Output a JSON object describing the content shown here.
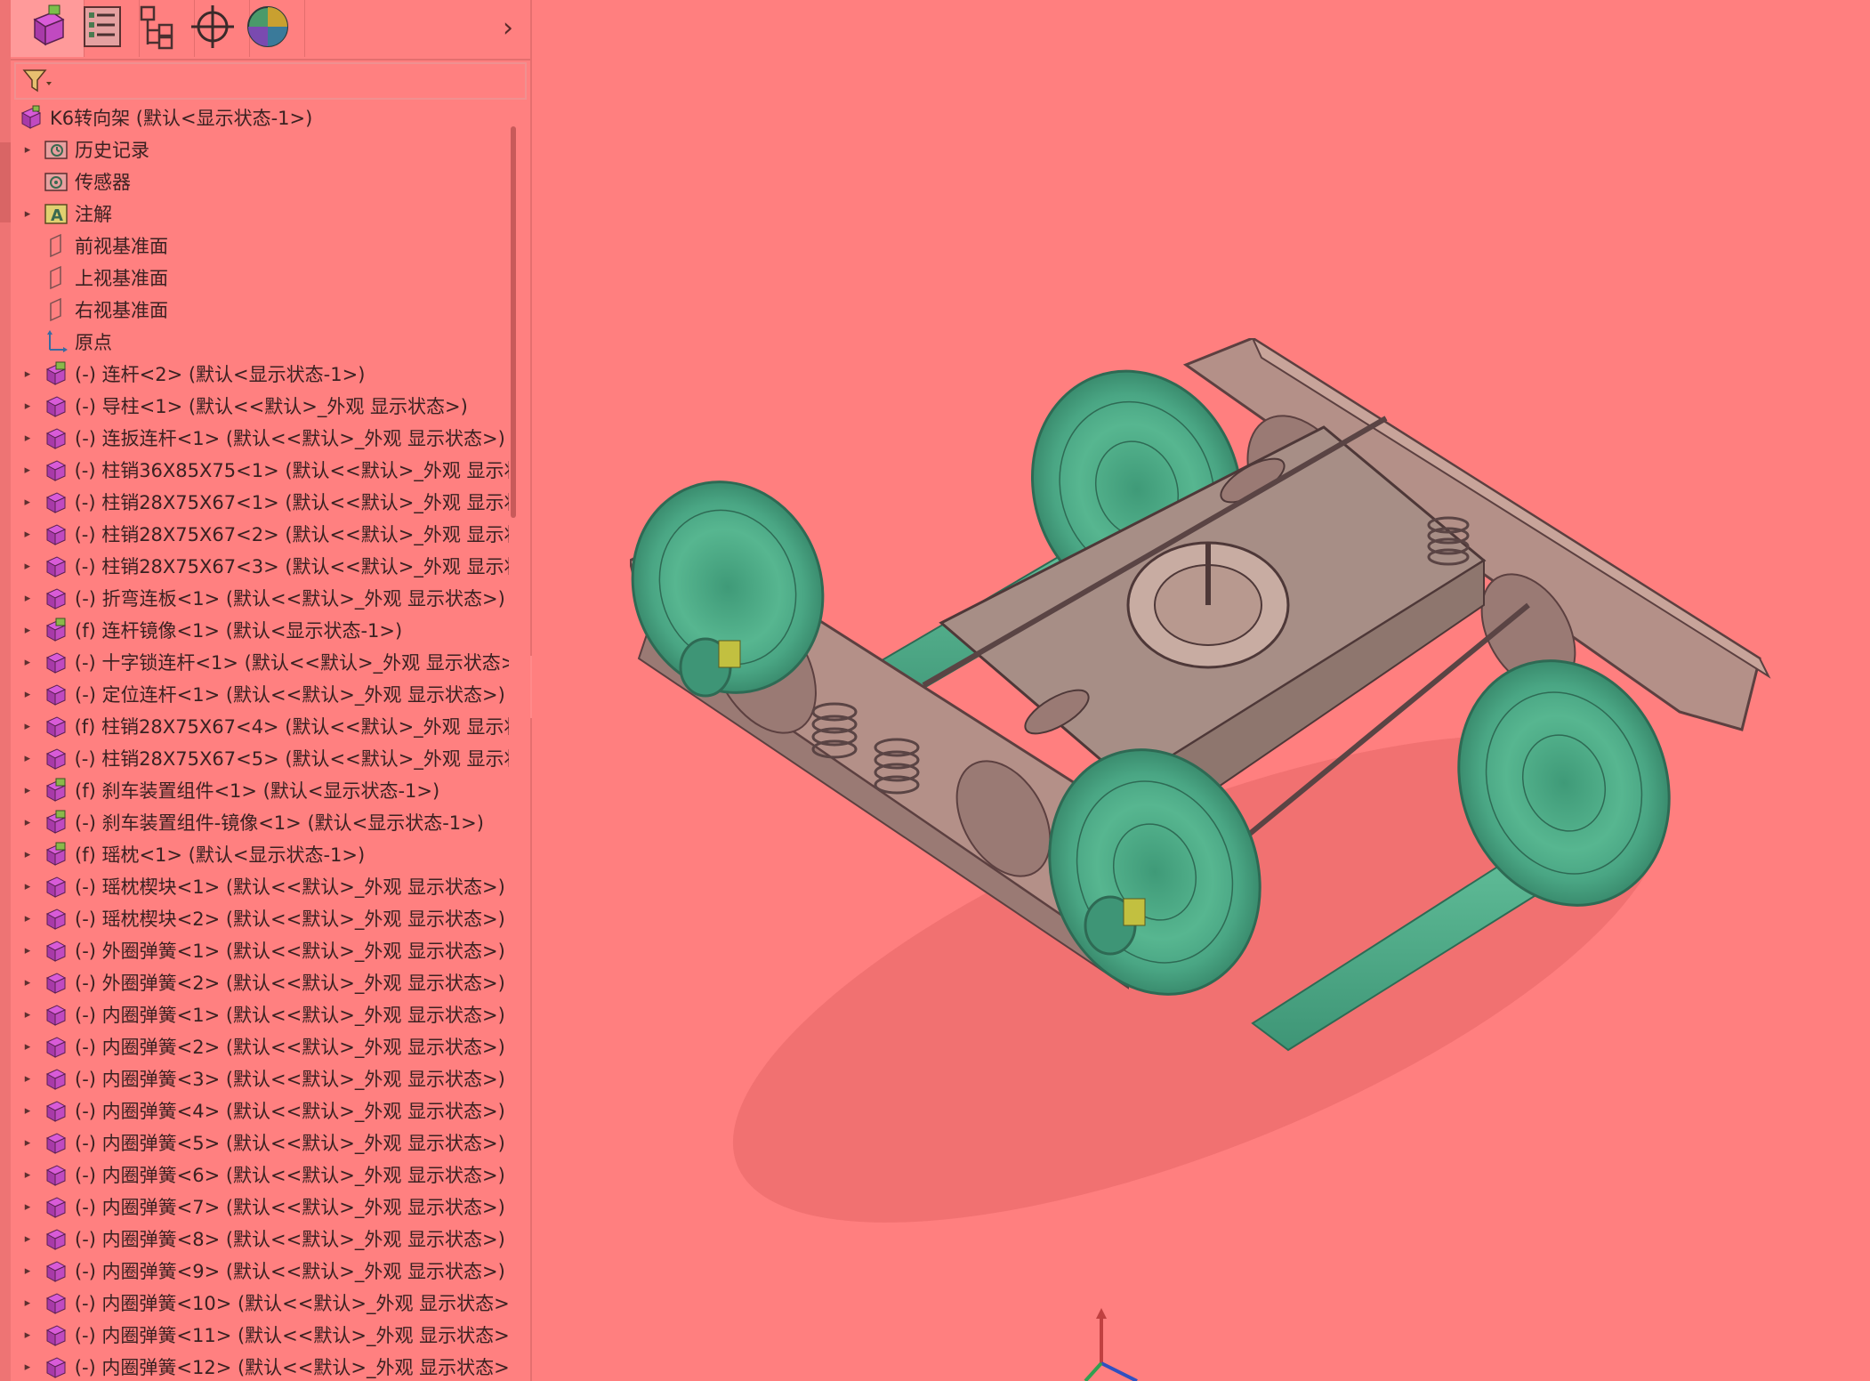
{
  "panel": {
    "tabs": [
      {
        "name": "feature-manager",
        "icon": "assembly-cube-icon"
      },
      {
        "name": "property-manager",
        "icon": "property-list-icon"
      },
      {
        "name": "configuration-manager",
        "icon": "configuration-icon"
      },
      {
        "name": "dimxpert-manager",
        "icon": "crosshair-icon"
      },
      {
        "name": "display-manager",
        "icon": "appearance-sphere-icon"
      }
    ],
    "more_glyph": "›",
    "filter_icon": "filter-funnel-icon"
  },
  "tree": {
    "root": "K6转向架 (默认<显示状态-1>)",
    "items": [
      {
        "label": "历史记录",
        "icon": "history-folder-icon",
        "expandable": true
      },
      {
        "label": "传感器",
        "icon": "sensor-folder-icon",
        "expandable": false
      },
      {
        "label": "注解",
        "icon": "annotation-icon",
        "expandable": true
      },
      {
        "label": "前视基准面",
        "icon": "plane-icon",
        "expandable": false
      },
      {
        "label": "上视基准面",
        "icon": "plane-icon",
        "expandable": false
      },
      {
        "label": "右视基准面",
        "icon": "plane-icon",
        "expandable": false
      },
      {
        "label": "原点",
        "icon": "origin-icon",
        "expandable": false
      },
      {
        "label": "(-) 连杆<2> (默认<显示状态-1>)",
        "icon": "subassembly-icon",
        "expandable": true
      },
      {
        "label": "(-) 导柱<1> (默认<<默认>_外观 显示状态>)",
        "icon": "part-icon",
        "expandable": true
      },
      {
        "label": "(-) 连扳连杆<1> (默认<<默认>_外观 显示状态>)",
        "icon": "part-icon",
        "expandable": true
      },
      {
        "label": "(-) 柱销36X85X75<1> (默认<<默认>_外观 显示状",
        "icon": "part-icon",
        "expandable": true
      },
      {
        "label": "(-) 柱销28X75X67<1> (默认<<默认>_外观 显示状",
        "icon": "part-icon",
        "expandable": true
      },
      {
        "label": "(-) 柱销28X75X67<2> (默认<<默认>_外观 显示状",
        "icon": "part-icon",
        "expandable": true
      },
      {
        "label": "(-) 柱销28X75X67<3> (默认<<默认>_外观 显示状",
        "icon": "part-icon",
        "expandable": true
      },
      {
        "label": "(-) 折弯连板<1> (默认<<默认>_外观 显示状态>)",
        "icon": "part-icon",
        "expandable": true
      },
      {
        "label": "(f) 连杆镜像<1> (默认<显示状态-1>)",
        "icon": "subassembly-icon",
        "expandable": true
      },
      {
        "label": "(-) 十字锁连杆<1> (默认<<默认>_外观 显示状态>",
        "icon": "part-icon",
        "expandable": true
      },
      {
        "label": "(-) 定位连杆<1> (默认<<默认>_外观 显示状态>)",
        "icon": "part-icon",
        "expandable": true
      },
      {
        "label": "(f) 柱销28X75X67<4> (默认<<默认>_外观 显示状",
        "icon": "part-icon",
        "expandable": true
      },
      {
        "label": "(-) 柱销28X75X67<5> (默认<<默认>_外观 显示状",
        "icon": "part-icon",
        "expandable": true
      },
      {
        "label": "(f) 刹车装置组件<1> (默认<显示状态-1>)",
        "icon": "subassembly-icon",
        "expandable": true
      },
      {
        "label": "(-) 刹车装置组件-镜像<1> (默认<显示状态-1>)",
        "icon": "subassembly-icon",
        "expandable": true
      },
      {
        "label": "(f) 瑶枕<1> (默认<显示状态-1>)",
        "icon": "subassembly-icon",
        "expandable": true
      },
      {
        "label": "(-) 瑶枕楔块<1> (默认<<默认>_外观 显示状态>)",
        "icon": "part-icon",
        "expandable": true
      },
      {
        "label": "(-) 瑶枕楔块<2> (默认<<默认>_外观 显示状态>)",
        "icon": "part-icon",
        "expandable": true
      },
      {
        "label": "(-) 外圈弹簧<1> (默认<<默认>_外观 显示状态>)",
        "icon": "part-icon",
        "expandable": true
      },
      {
        "label": "(-) 外圈弹簧<2> (默认<<默认>_外观 显示状态>)",
        "icon": "part-icon",
        "expandable": true
      },
      {
        "label": "(-) 内圈弹簧<1> (默认<<默认>_外观 显示状态>)",
        "icon": "part-icon",
        "expandable": true
      },
      {
        "label": "(-) 内圈弹簧<2> (默认<<默认>_外观 显示状态>)",
        "icon": "part-icon",
        "expandable": true
      },
      {
        "label": "(-) 内圈弹簧<3> (默认<<默认>_外观 显示状态>)",
        "icon": "part-icon",
        "expandable": true
      },
      {
        "label": "(-) 内圈弹簧<4> (默认<<默认>_外观 显示状态>)",
        "icon": "part-icon",
        "expandable": true
      },
      {
        "label": "(-) 内圈弹簧<5> (默认<<默认>_外观 显示状态>)",
        "icon": "part-icon",
        "expandable": true
      },
      {
        "label": "(-) 内圈弹簧<6> (默认<<默认>_外观 显示状态>)",
        "icon": "part-icon",
        "expandable": true
      },
      {
        "label": "(-) 内圈弹簧<7> (默认<<默认>_外观 显示状态>)",
        "icon": "part-icon",
        "expandable": true
      },
      {
        "label": "(-) 内圈弹簧<8> (默认<<默认>_外观 显示状态>)",
        "icon": "part-icon",
        "expandable": true
      },
      {
        "label": "(-) 内圈弹簧<9> (默认<<默认>_外观 显示状态>)",
        "icon": "part-icon",
        "expandable": true
      },
      {
        "label": "(-) 内圈弹簧<10> (默认<<默认>_外观 显示状态>)",
        "icon": "part-icon",
        "expandable": true
      },
      {
        "label": "(-) 内圈弹簧<11> (默认<<默认>_外观 显示状态>)",
        "icon": "part-icon",
        "expandable": true
      },
      {
        "label": "(-) 内圈弹簧<12> (默认<<默认>_外观 显示状态>)",
        "icon": "part-icon",
        "expandable": true
      }
    ]
  },
  "viewport": {
    "model_icon": "bogie-assembly-model",
    "triad_icon": "reference-triad-icon"
  },
  "colors": {
    "background": "#ff7f7f",
    "model_green": "#4fae8c",
    "frame_gray": "#b0928a"
  }
}
